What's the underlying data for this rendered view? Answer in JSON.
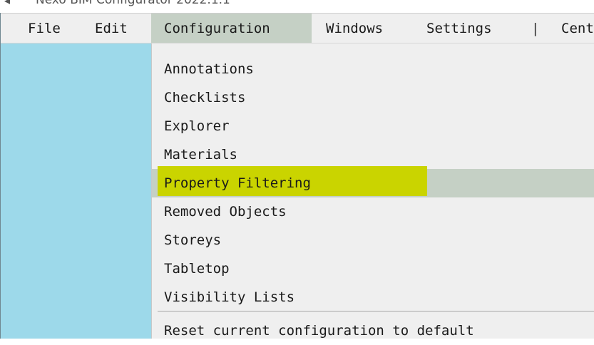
{
  "window": {
    "title_icon": "◂",
    "title": "Nexo BIM Configurator 2022.1.1"
  },
  "menubar": {
    "items": [
      {
        "label": "File"
      },
      {
        "label": "Edit"
      },
      {
        "label": "Configuration",
        "active": true
      },
      {
        "label": "Windows"
      },
      {
        "label": "Settings"
      },
      {
        "label": "|"
      },
      {
        "label": "Cent"
      }
    ]
  },
  "configuration_menu": {
    "items": [
      {
        "label": "Annotations"
      },
      {
        "label": "Checklists"
      },
      {
        "label": "Explorer"
      },
      {
        "label": "Materials"
      },
      {
        "label": "Property Filtering",
        "hovered": true,
        "highlighted": true
      },
      {
        "label": "Removed Objects"
      },
      {
        "label": "Storeys"
      },
      {
        "label": "Tabletop"
      },
      {
        "label": "Visibility Lists"
      },
      {
        "label": "Reset current configuration to default"
      }
    ]
  },
  "colors": {
    "menubar_bg": "#efefef",
    "hover_bg": "#c5d0c5",
    "highlighter": "#cad400",
    "left_panel": "#9dd9ea"
  }
}
